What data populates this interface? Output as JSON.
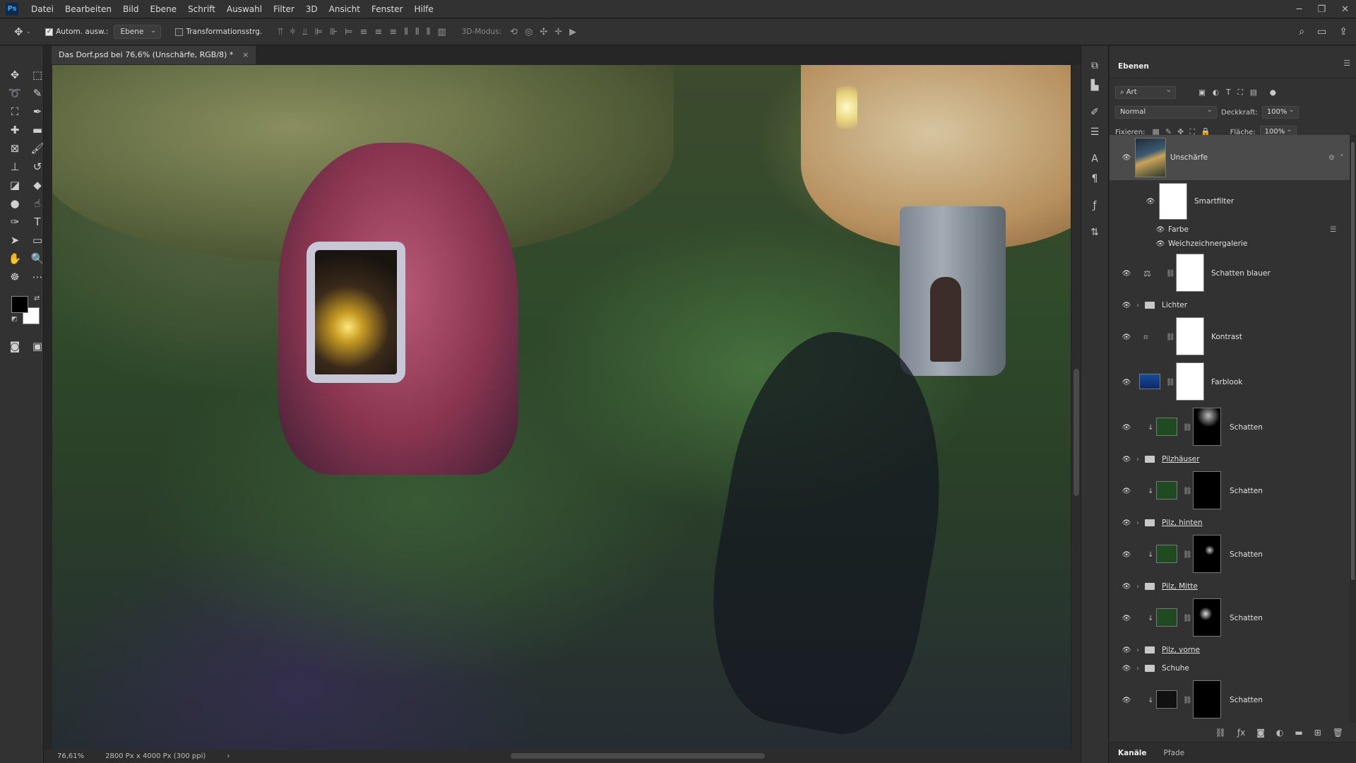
{
  "menubar": {
    "logo": "Ps",
    "items": [
      "Datei",
      "Bearbeiten",
      "Bild",
      "Ebene",
      "Schrift",
      "Auswahl",
      "Filter",
      "3D",
      "Ansicht",
      "Fenster",
      "Hilfe"
    ]
  },
  "options": {
    "auto_select_label": "Autom. ausw.:",
    "auto_select_value": "Ebene",
    "transform_label": "Transformationsstrg.",
    "mode3d_label": "3D-Modus:"
  },
  "document": {
    "tab_title": "Das Dorf.psd bei 76,6% (Unschärfe, RGB/8) *",
    "zoom": "76,61%",
    "info": "2800 Px x 4000 Px (300 ppi)"
  },
  "layers_panel": {
    "tab": "Ebenen",
    "filter_kind": "Art",
    "blend_mode": "Normal",
    "opacity_label": "Deckkraft:",
    "opacity_value": "100%",
    "lock_label": "Fixieren:",
    "fill_label": "Fläche:",
    "fill_value": "100%",
    "layers": [
      {
        "name": "Unschärfe"
      },
      {
        "name": "Smartfilter"
      },
      {
        "name": "Farbe"
      },
      {
        "name": "Weichzeichnergalerie"
      },
      {
        "name": "Schatten blauer"
      },
      {
        "name": "Lichter"
      },
      {
        "name": "Kontrast"
      },
      {
        "name": "Farblook"
      },
      {
        "name": "Schatten"
      },
      {
        "name": "Pilzhäuser"
      },
      {
        "name": "Schatten"
      },
      {
        "name": "Pilz, hinten"
      },
      {
        "name": "Schatten"
      },
      {
        "name": "Pilz, Mitte"
      },
      {
        "name": "Schatten"
      },
      {
        "name": "Pilz, vorne"
      },
      {
        "name": "Schuhe"
      },
      {
        "name": "Schatten"
      }
    ],
    "bottom_tabs": [
      "Kanäle",
      "Pfade"
    ]
  },
  "colors": {
    "foreground": "#000000",
    "background": "#ffffff",
    "accent": "#31a8ff"
  }
}
